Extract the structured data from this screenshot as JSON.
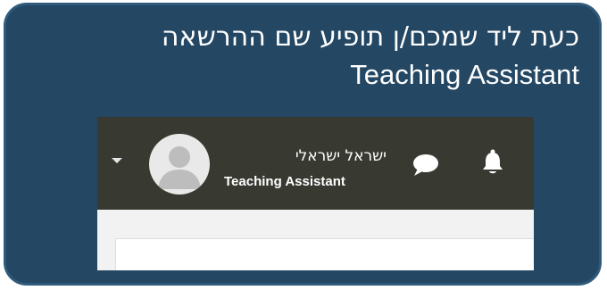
{
  "headline": {
    "line1": "כעת ליד שמכם/ן תופיע שם ההרשאה",
    "line2": "Teaching Assistant"
  },
  "screenshot": {
    "user": {
      "name": "ישראל ישראלי",
      "role": "Teaching Assistant"
    },
    "icons": {
      "menu": "chevron-down-icon",
      "avatar": "user-avatar-icon",
      "messages": "chat-bubble-icon",
      "notifications": "bell-icon"
    }
  },
  "colors": {
    "card_background": "#244763",
    "card_border": "#2f5a7b",
    "topbar": "#383a32",
    "page_background": "#f2f2f2",
    "text": "#ffffff"
  }
}
